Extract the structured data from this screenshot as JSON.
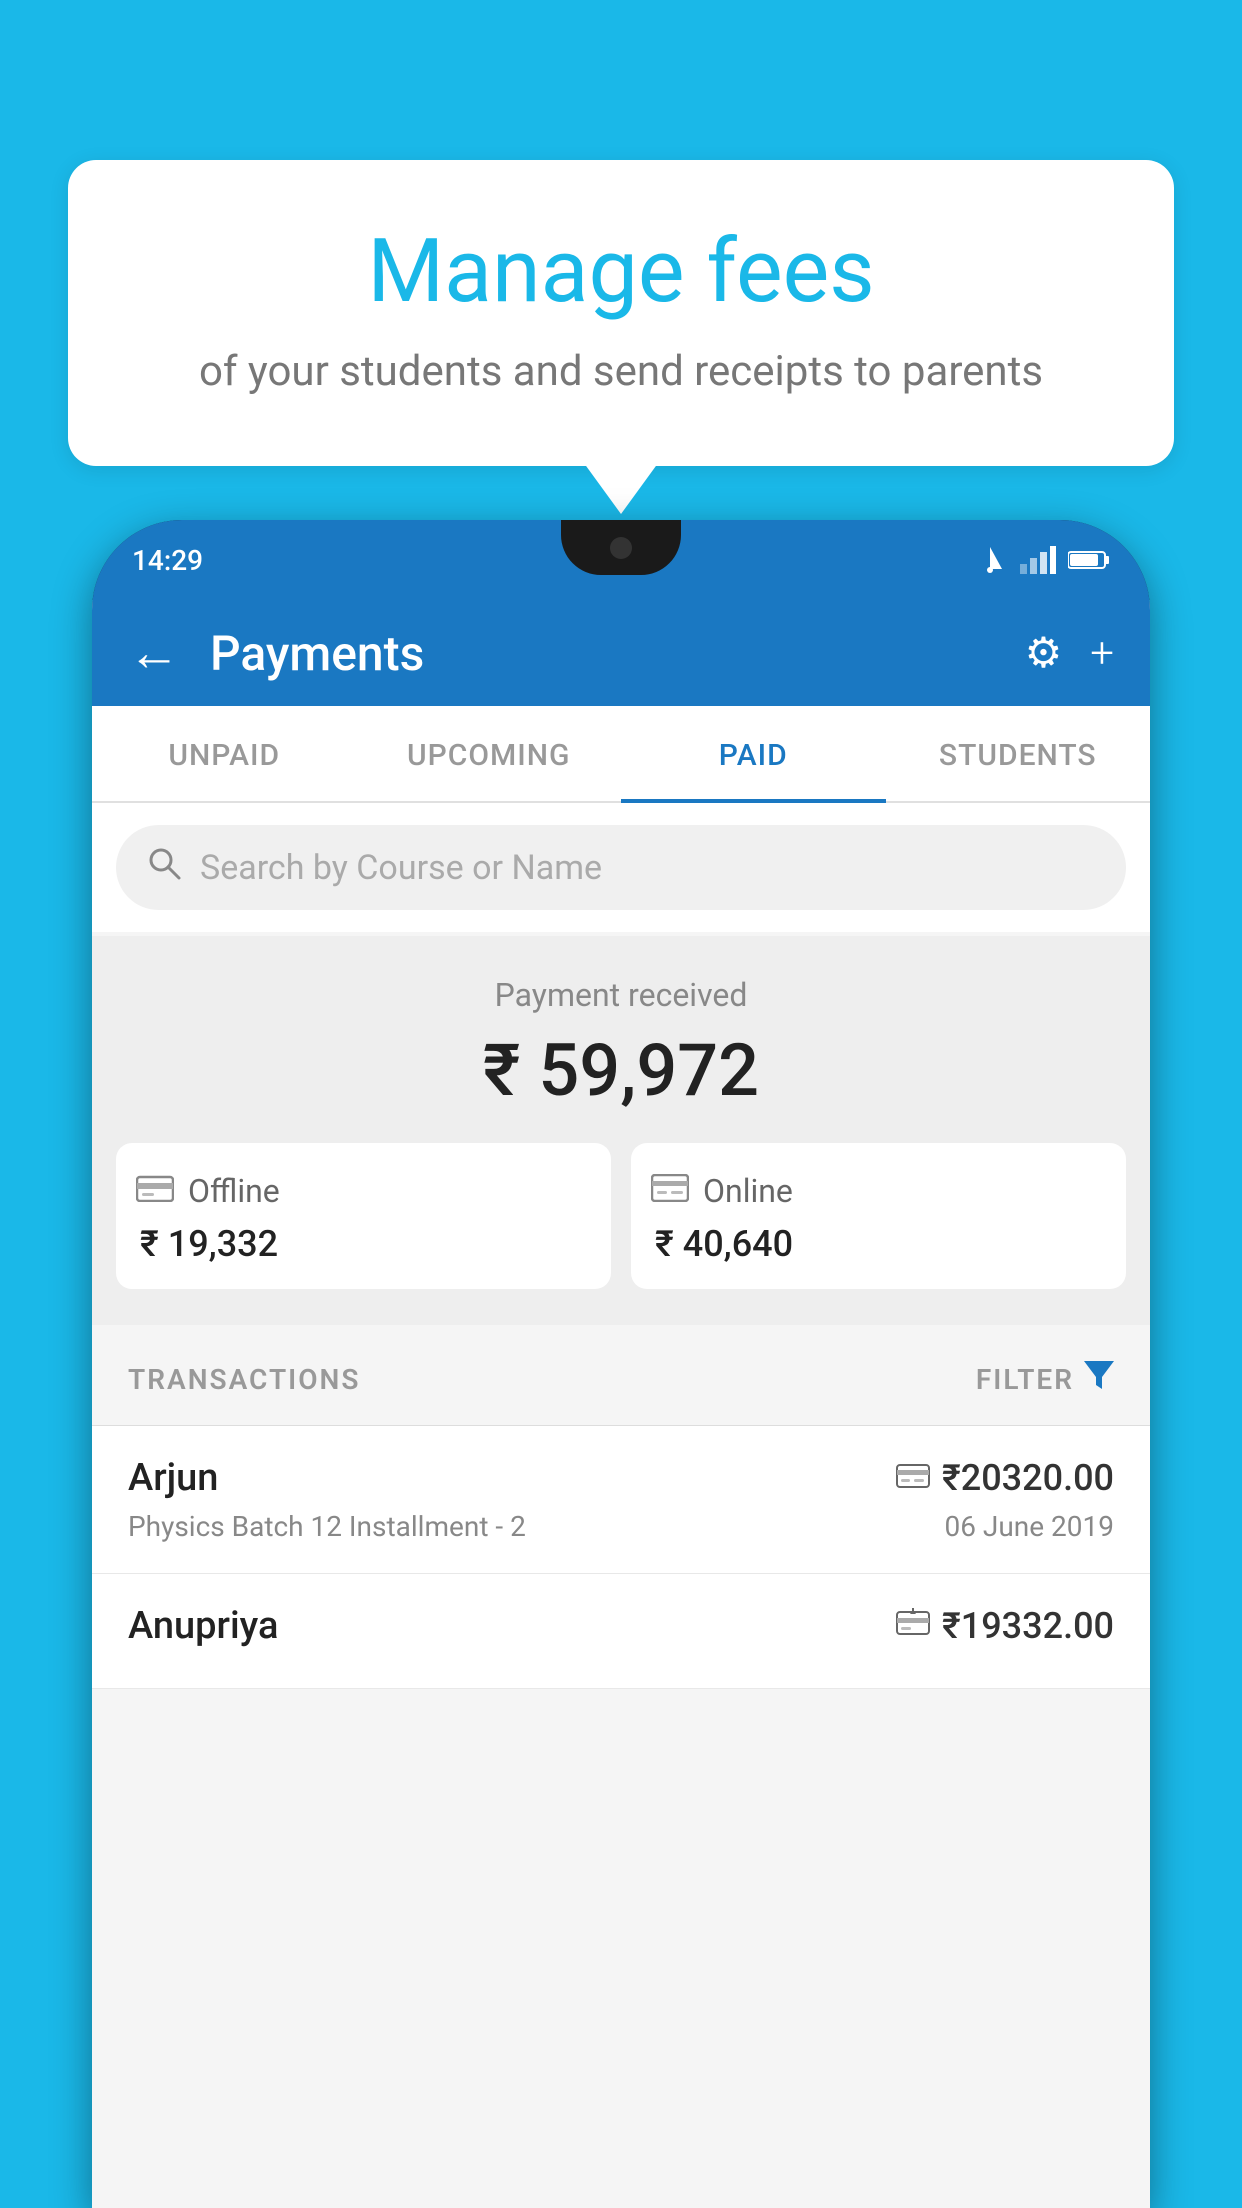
{
  "background": {
    "color": "#1ab8e8"
  },
  "speech_bubble": {
    "title": "Manage fees",
    "subtitle": "of your students and send receipts to parents"
  },
  "phone": {
    "status_bar": {
      "time": "14:29",
      "wifi": "▲",
      "signal": "▲",
      "battery": "▌"
    },
    "header": {
      "back_label": "←",
      "title": "Payments",
      "settings_label": "⚙",
      "add_label": "+"
    },
    "tabs": [
      {
        "label": "UNPAID",
        "active": false
      },
      {
        "label": "UPCOMING",
        "active": false
      },
      {
        "label": "PAID",
        "active": true
      },
      {
        "label": "STUDENTS",
        "active": false
      }
    ],
    "search": {
      "placeholder": "Search by Course or Name"
    },
    "payment_summary": {
      "label": "Payment received",
      "amount": "₹ 59,972",
      "offline_label": "Offline",
      "offline_amount": "₹ 19,332",
      "online_label": "Online",
      "online_amount": "₹ 40,640"
    },
    "transactions": {
      "header_label": "TRANSACTIONS",
      "filter_label": "FILTER",
      "rows": [
        {
          "name": "Arjun",
          "course": "Physics Batch 12 Installment - 2",
          "amount": "₹20320.00",
          "date": "06 June 2019",
          "payment_type": "online"
        },
        {
          "name": "Anupriya",
          "course": "",
          "amount": "₹19332.00",
          "date": "",
          "payment_type": "offline"
        }
      ]
    }
  }
}
